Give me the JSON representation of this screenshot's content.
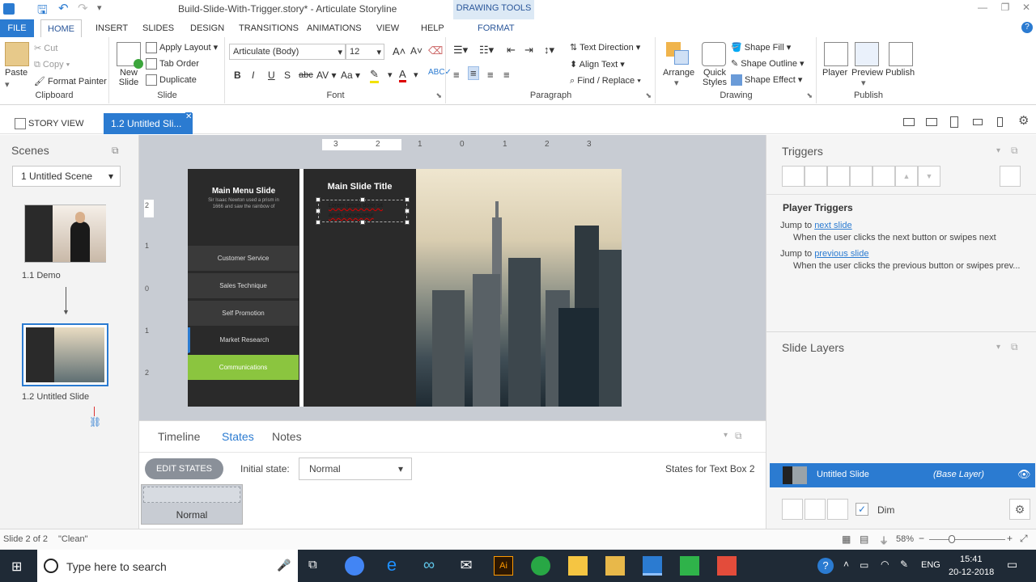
{
  "window": {
    "title": "Build-Slide-With-Trigger.story* - Articulate Storyline",
    "contextual_tab_group": "DRAWING TOOLS"
  },
  "ribbon_tabs": [
    "FILE",
    "HOME",
    "INSERT",
    "SLIDES",
    "DESIGN",
    "TRANSITIONS",
    "ANIMATIONS",
    "VIEW",
    "HELP",
    "FORMAT"
  ],
  "clipboard": {
    "paste": "Paste",
    "cut": "Cut",
    "copy": "Copy",
    "format_painter": "Format Painter",
    "group": "Clipboard"
  },
  "slide_group": {
    "new_slide": "New Slide",
    "apply_layout": "Apply Layout",
    "tab_order": "Tab Order",
    "duplicate": "Duplicate",
    "group": "Slide"
  },
  "font": {
    "family": "Articulate (Body)",
    "size": "12",
    "group": "Font"
  },
  "paragraph": {
    "text_direction": "Text Direction",
    "align_text": "Align Text",
    "find_replace": "Find / Replace",
    "group": "Paragraph"
  },
  "drawing": {
    "arrange": "Arrange",
    "quick_styles": "Quick Styles",
    "shape_fill": "Shape Fill",
    "shape_outline": "Shape Outline",
    "shape_effect": "Shape Effect",
    "group": "Drawing"
  },
  "publish": {
    "player": "Player",
    "preview": "Preview",
    "publish": "Publish",
    "group": "Publish"
  },
  "views": {
    "story_view": "STORY VIEW",
    "slide_tab": "1.2 Untitled Sli..."
  },
  "scenes": {
    "title": "Scenes",
    "selector": "1 Untitled Scene",
    "slides": [
      {
        "label": "1.1 Demo"
      },
      {
        "label": "1.2 Untitled Slide"
      }
    ]
  },
  "ruler": {
    "labels": [
      "3",
      "2",
      "1",
      "0",
      "1",
      "2",
      "3"
    ],
    "vlabels": [
      "2",
      "1",
      "0",
      "1",
      "2"
    ]
  },
  "slide": {
    "left_panel": {
      "title": "Main Menu Slide",
      "text": "Sir Isaac Newton used a prism in 1666 and saw the rainbow of",
      "items": [
        "Customer Service",
        "Sales Technique",
        "Self Promotion",
        "Market Research",
        "Communications"
      ]
    },
    "middle_panel": {
      "title": "Main Slide Title",
      "body_line1": "Lorem ipsum dolor sit",
      "body_line2": "amet, consectetur"
    }
  },
  "bottom_tabs": {
    "timeline": "Timeline",
    "states": "States",
    "notes": "Notes"
  },
  "states": {
    "edit_button": "EDIT STATES",
    "initial_label": "Initial state:",
    "initial_value": "Normal",
    "states_for": "States for Text Box 2",
    "state_thumb": "Normal"
  },
  "triggers": {
    "title": "Triggers",
    "section": "Player Triggers",
    "items": [
      {
        "prefix": "Jump to ",
        "link": "next slide",
        "desc": "When the user clicks the next button or swipes next"
      },
      {
        "prefix": "Jump to ",
        "link": "previous slide",
        "desc": "When the user clicks the previous button or swipes prev..."
      }
    ]
  },
  "layers": {
    "title": "Slide Layers",
    "base_name": "Untitled Slide",
    "base_tag": "(Base Layer)",
    "dim": "Dim"
  },
  "status": {
    "slide": "Slide 2 of 2",
    "theme": "\"Clean\"",
    "zoom": "58%"
  },
  "taskbar": {
    "search_placeholder": "Type here to search",
    "lang": "ENG",
    "time": "15:41",
    "date": "20-12-2018"
  },
  "colors": {
    "accent": "#2b7bd1",
    "taskbar": "#1f2a36",
    "menu_green": "#8bc53f"
  }
}
